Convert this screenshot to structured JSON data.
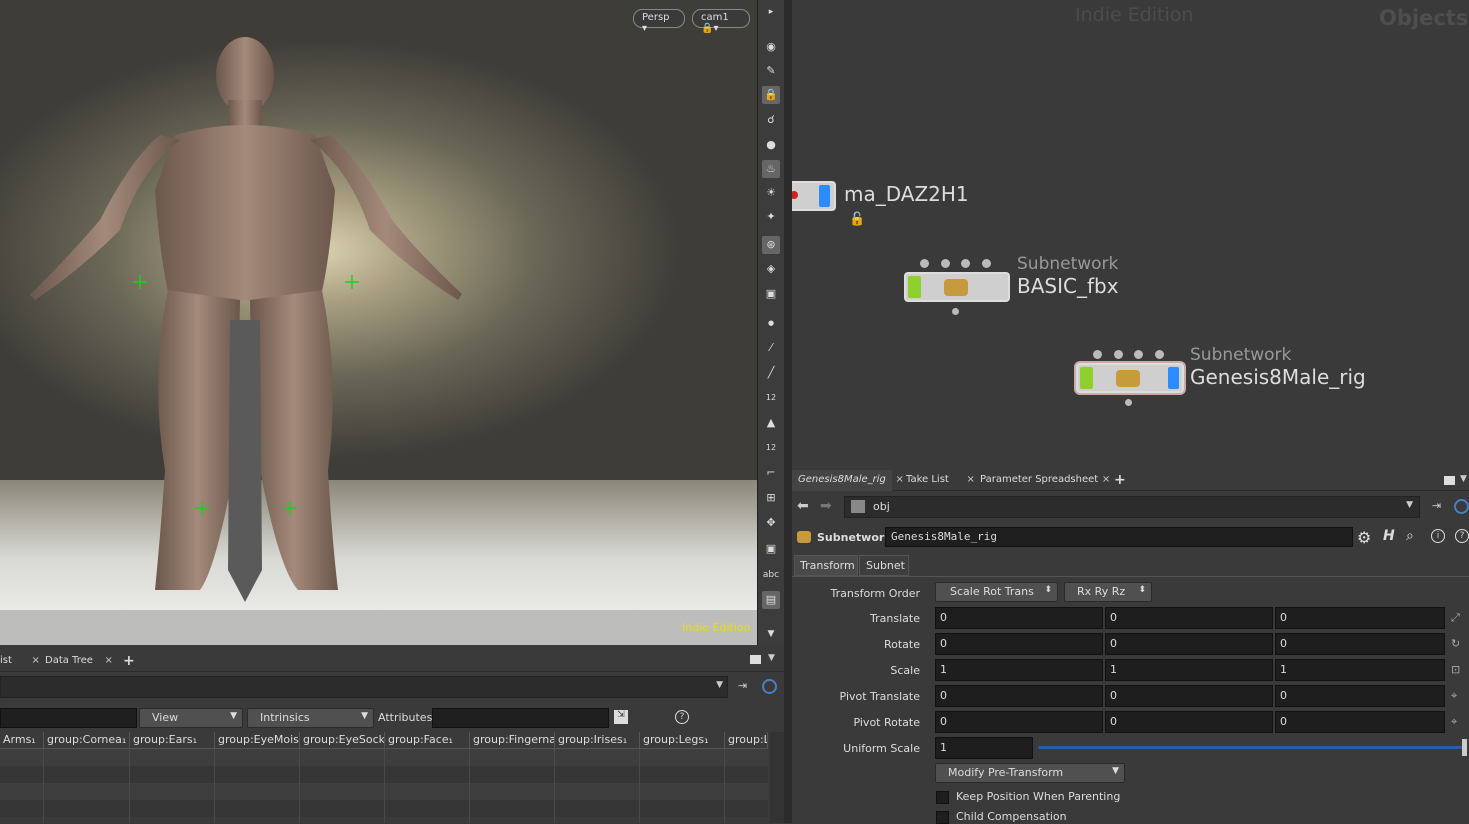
{
  "viewport": {
    "persp_label": "Persp",
    "cam_label": "cam1",
    "indie_label": "Indie Edition"
  },
  "shelf_icons": [
    "eye-icon",
    "brush-icon",
    "lock-icon",
    "ghost-icon",
    "sphere-icon",
    "bulb-icon",
    "light-icon",
    "camera-light-icon",
    "render-icon",
    "render-view-icon",
    "flipbook-icon",
    "point-icon",
    "line-icon",
    "line2-icon",
    "snap-12-icon",
    "shader-icon",
    "shader-12-icon",
    "curve-icon",
    "grid-icon",
    "move-icon",
    "box-icon",
    "abc",
    "image-icon",
    "down-icon"
  ],
  "sheet": {
    "tabs": [
      {
        "label": "ist"
      },
      {
        "label": "Data Tree"
      }
    ],
    "add_tab": "+",
    "view_label": "View",
    "intrinsics_label": "Intrinsics",
    "attributes_label": "Attributes:",
    "help_label": "?",
    "columns": [
      "Arms₁",
      "group:Cornea₁",
      "group:Ears₁",
      "group:EyeMoist",
      "group:EyeSocke",
      "group:Face₁",
      "group:Fingernai",
      "group:Irises₁",
      "group:Legs₁",
      "group:L"
    ]
  },
  "network": {
    "watermark": "Indie Edition",
    "context_label": "Objects",
    "nodes": [
      {
        "name": "ma_DAZ2H1",
        "type": ""
      },
      {
        "name": "BASIC_fbx",
        "type": "Subnetwork"
      },
      {
        "name": "Genesis8Male_rig",
        "type": "Subnetwork"
      }
    ]
  },
  "params": {
    "tabs": [
      {
        "label": "Genesis8Male_rig"
      },
      {
        "label": "Take List"
      },
      {
        "label": "Parameter Spreadsheet"
      }
    ],
    "add_tab": "+",
    "path": "obj",
    "node_type": "Subnetwork",
    "node_name": "Genesis8Male_rig",
    "subtabs": [
      "Transform",
      "Subnet"
    ],
    "transform_order_label": "Transform Order",
    "transform_order": "Scale Rot Trans",
    "rotate_order": "Rx Ry Rz",
    "rows": [
      {
        "label": "Translate",
        "values": [
          "0",
          "0",
          "0"
        ]
      },
      {
        "label": "Rotate",
        "values": [
          "0",
          "0",
          "0"
        ]
      },
      {
        "label": "Scale",
        "values": [
          "1",
          "1",
          "1"
        ]
      },
      {
        "label": "Pivot Translate",
        "values": [
          "0",
          "0",
          "0"
        ]
      },
      {
        "label": "Pivot Rotate",
        "values": [
          "0",
          "0",
          "0"
        ]
      }
    ],
    "uniform_scale_label": "Uniform Scale",
    "uniform_scale": "1",
    "modify_pre_transform": "Modify Pre-Transform",
    "keep_position_label": "Keep Position When Parenting",
    "child_comp_label": "Child Compensation"
  }
}
